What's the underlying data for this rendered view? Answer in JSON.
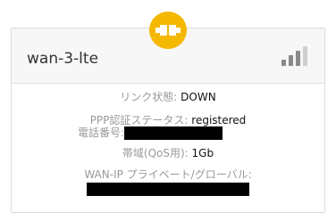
{
  "card": {
    "title": "wan-3-lte",
    "icons": {
      "status": "plug-connected-icon",
      "signal": "signal-strength-icon"
    },
    "signal": {
      "bars_total": 4,
      "bars_active": 3
    },
    "colors": {
      "accent": "#f5b800",
      "signal_active": "#8a8a8a",
      "signal_inactive": "#cfcfcf"
    },
    "fields": {
      "link_status": {
        "label": "リンク状態:",
        "value": "DOWN"
      },
      "ppp_auth": {
        "label": "PPP認証ステータス:",
        "value": "registered"
      },
      "phone": {
        "label": "電話番号:"
      },
      "bandwidth": {
        "label": "帯域(QoS用):",
        "value": "1Gb"
      },
      "wan_ip": {
        "label": "WAN-IP プライベート/グローバル:"
      }
    }
  }
}
